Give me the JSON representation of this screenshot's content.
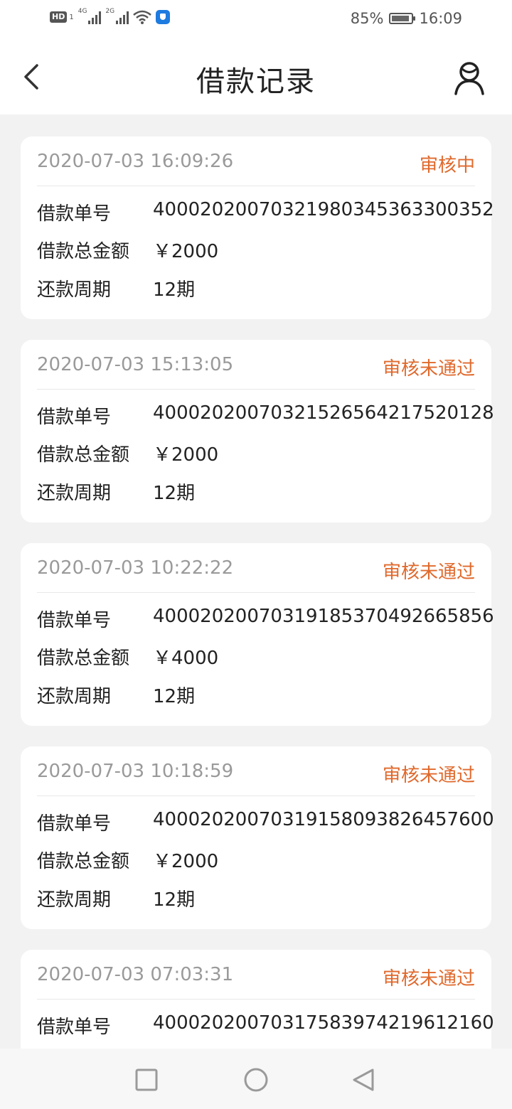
{
  "status_bar": {
    "hd": "HD",
    "sim": "1",
    "net1": "4G",
    "net2": "2G",
    "battery_pct": "85%",
    "time": "16:09"
  },
  "header": {
    "title": "借款记录",
    "back_icon": "chevron-left-icon",
    "user_icon": "user-icon"
  },
  "labels": {
    "order_no": "借款单号",
    "total_amount": "借款总金额",
    "period": "还款周期"
  },
  "records": [
    {
      "time": "2020-07-03 16:09:26",
      "status": "审核中",
      "order_no": "4000202007032198034536330035 2",
      "amount": "￥2000",
      "period": "12期"
    },
    {
      "time": "2020-07-03 15:13:05",
      "status": "审核未通过",
      "order_no": "40002020070321526564217520128",
      "amount": "￥2000",
      "period": "12期"
    },
    {
      "time": "2020-07-03 10:22:22",
      "status": "审核未通过",
      "order_no": "40002020070319185370492665856",
      "amount": "￥4000",
      "period": "12期"
    },
    {
      "time": "2020-07-03 10:18:59",
      "status": "审核未通过",
      "order_no": "40002020070319158093826457600",
      "amount": "￥2000",
      "period": "12期"
    },
    {
      "time": "2020-07-03 07:03:31",
      "status": "审核未通过",
      "order_no": "40002020070317583974219612160",
      "amount": "",
      "period": ""
    }
  ],
  "colors": {
    "status": "#e0692c",
    "time": "#9a9a9a",
    "background": "#f2f2f2"
  }
}
